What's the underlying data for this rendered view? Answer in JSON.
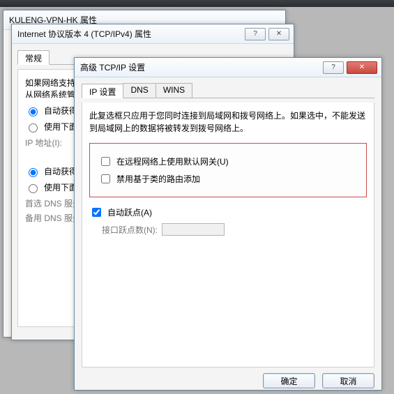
{
  "win1": {
    "title": "KULENG-VPN-HK 属性"
  },
  "win2": {
    "title": "Internet 协议版本 4 (TCP/IPv4) 属性",
    "tab_general": "常规",
    "intro": "如果网络支持此功能，则可以获取自动指派的 IP 设置。否则，您需要从网络系统管理员处获得适当的 IP 设置。",
    "auto_obtain": "自动获得 IP 地址(O)",
    "use_following": "使用下面的 IP 地址(S):",
    "ip_label": "IP 地址(I):",
    "auto_dns": "自动获得 DNS 服务器地址(B)",
    "use_dns": "使用下面的 DNS 服务器地址(E):",
    "pref_dns": "首选 DNS 服务器(P):",
    "alt_dns": "备用 DNS 服务器(A):"
  },
  "win3": {
    "title": "高级 TCP/IP 设置",
    "tabs": {
      "ip": "IP 设置",
      "dns": "DNS",
      "wins": "WINS"
    },
    "intro": "此复选框只应用于您同时连接到局域网和拨号网络上。如果选中，不能发送到局域网上的数据将被转发到拨号网络上。",
    "remote_gateway": "在远程网络上使用默认网关(U)",
    "disable_class_route": "禁用基于类的路由添加",
    "auto_metric": "自动跃点(A)",
    "metric_label": "接口跃点数(N):",
    "ok": "确定",
    "cancel": "取消",
    "help_icon": "?",
    "close_icon": "✕"
  }
}
